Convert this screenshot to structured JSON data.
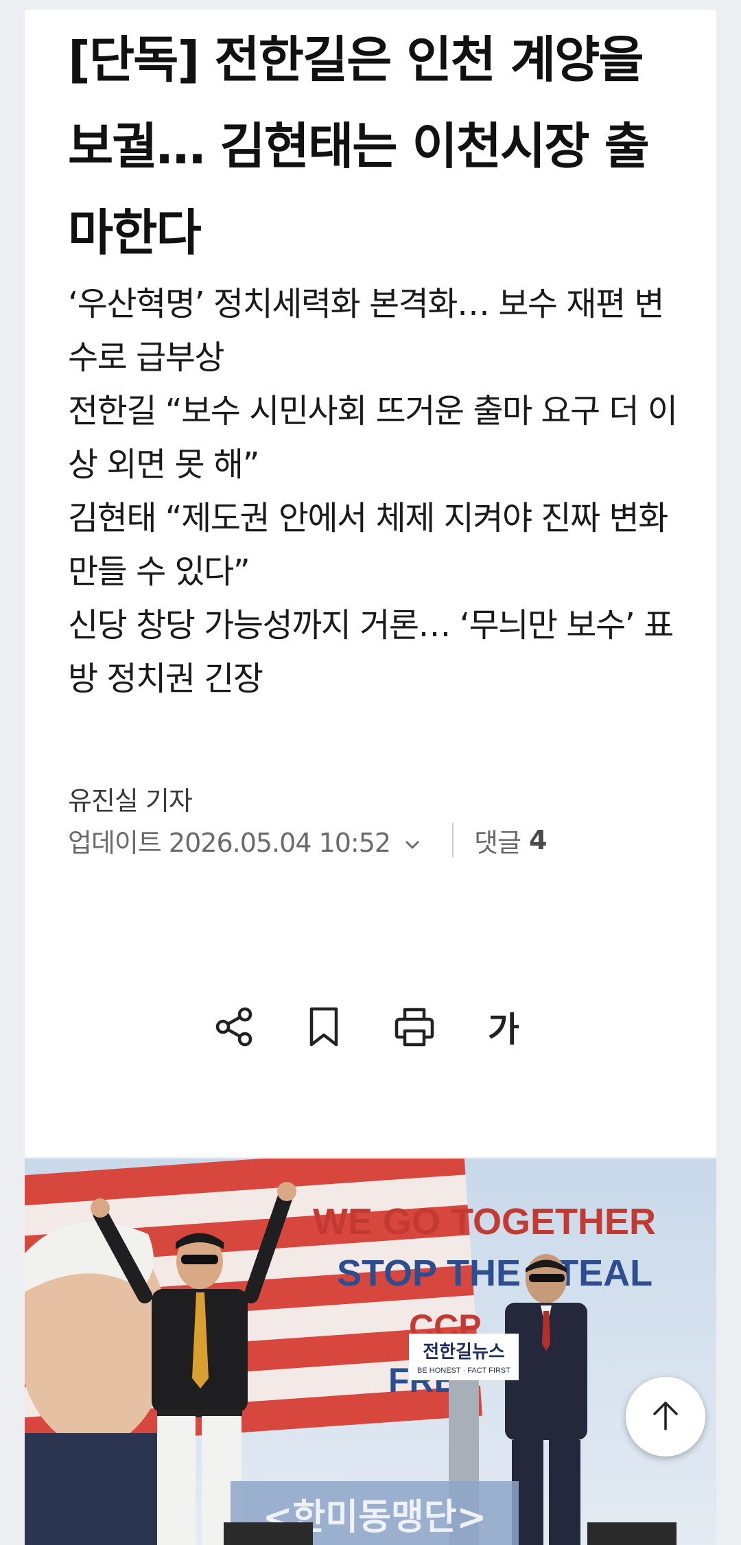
{
  "article": {
    "headline": "[단독] 전한길은 인천 계양을 보궐… 김현태는 이천시장 출마한다",
    "subheads": [
      "‘우산혁명’ 정치세력화 본격화… 보수 재편 변수로 급부상",
      "전한길 “보수 시민사회 뜨거운 출마 요구 더 이상 외면 못 해”",
      "김현태 “제도권 안에서 체제 지켜야 진짜 변화 만들 수 있다”",
      "신당 창당 가능성까지 거론… ‘무늬만 보수’ 표방 정치권 긴장"
    ],
    "author": "유진실 기자",
    "update_label": "업데이트 2026.05.04 10:52",
    "comments_label": "댓글",
    "comments_count": "4"
  },
  "toolbar": {
    "share_icon": "share-icon",
    "bookmark_icon": "bookmark-icon",
    "print_icon": "print-icon",
    "font_size_label": "가"
  },
  "photo": {
    "banner_line1": "WE GO TOGETHER",
    "banner_line2": "STOP THE STEAL",
    "banner_line3": "CCP",
    "banner_line4": "FREE",
    "podium_logo": "전한길뉴스",
    "podium_slogan": "BE HONEST · FACT FIRST",
    "stage_sign": "<한미동맹단>"
  },
  "scroll_top_icon": "arrow-up-icon",
  "colors": {
    "background": "#eceef1",
    "card": "#ffffff",
    "text": "#111111",
    "meta_text": "#6a6a6a"
  }
}
